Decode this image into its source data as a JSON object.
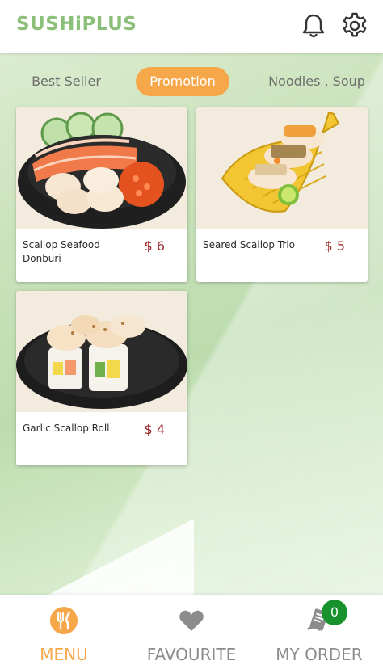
{
  "header": {
    "logo": "SUSHiPLUS",
    "icons": {
      "notifications": "bell-icon",
      "settings": "gear-icon"
    }
  },
  "tabs": [
    {
      "label": "Best Seller",
      "active": false
    },
    {
      "label": "Promotion",
      "active": true
    },
    {
      "label": "Noodles , Soup",
      "active": false
    }
  ],
  "products": [
    {
      "name": "Scallop Seafood Donburi",
      "price": "$ 6",
      "image": "scallop-seafood-donburi-photo"
    },
    {
      "name": "Seared Scallop Trio",
      "price": "$ 5",
      "image": "seared-scallop-trio-photo"
    },
    {
      "name": "Garlic Scallop Roll",
      "price": "$ 4",
      "image": "garlic-scallop-roll-photo"
    }
  ],
  "bottom_nav": {
    "items": [
      {
        "label": "MENU",
        "icon": "menu-utensils-icon",
        "active": true
      },
      {
        "label": "FAVOURITE",
        "icon": "heart-icon",
        "active": false
      },
      {
        "label": "MY ORDER",
        "icon": "receipt-icon",
        "active": false
      }
    ],
    "order_count": "0"
  },
  "colors": {
    "brand": "#8bbf7a",
    "accent": "#f6a749",
    "price": "#a0282b",
    "badge": "#17922c"
  }
}
